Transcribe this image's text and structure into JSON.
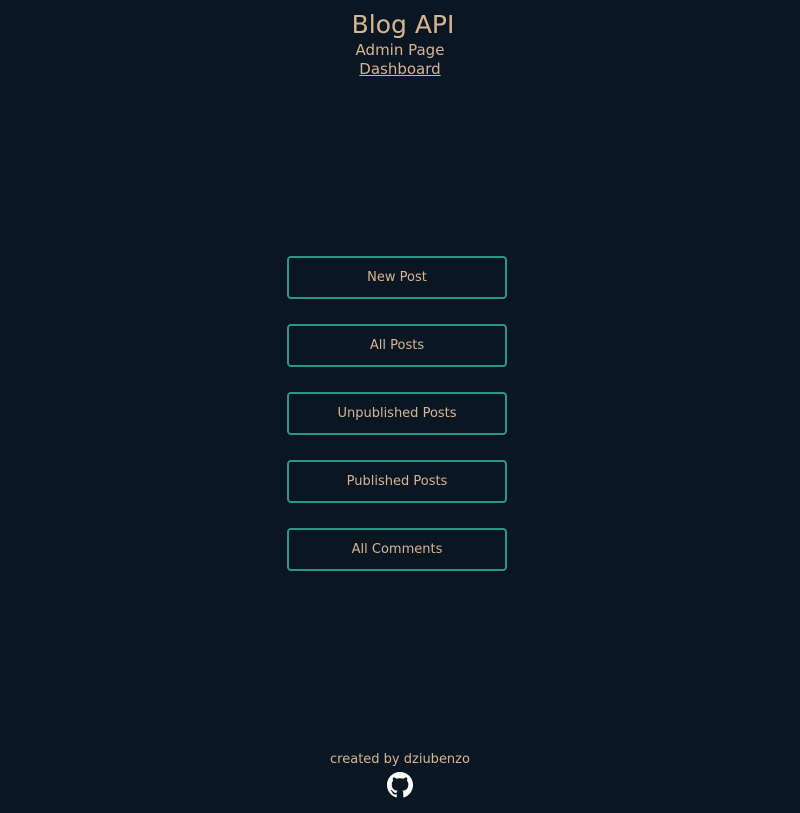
{
  "header": {
    "title": "Blog API",
    "subtitle": "Admin Page",
    "dashboard_link": "Dashboard"
  },
  "menu": {
    "buttons": [
      {
        "label": "New Post"
      },
      {
        "label": "All Posts"
      },
      {
        "label": "Unpublished Posts"
      },
      {
        "label": "Published Posts"
      },
      {
        "label": "All Comments"
      }
    ]
  },
  "footer": {
    "credit": "created by dziubenzo",
    "icon": "github-icon"
  },
  "colors": {
    "background": "#0b1623",
    "text": "#d6b593",
    "button_border": "#2a9687",
    "icon": "#ffffff"
  }
}
